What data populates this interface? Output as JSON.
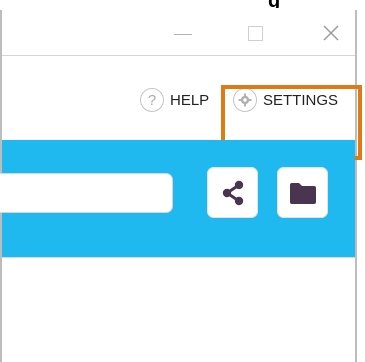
{
  "titlebar": {
    "partial_title": "g",
    "controls": {
      "minimize": "minimize",
      "maximize": "maximize",
      "close": "close"
    }
  },
  "toolbar": {
    "help": {
      "label": "HELP",
      "icon": "question-circle-icon"
    },
    "settings": {
      "label": "SETTINGS",
      "icon": "gear-icon"
    }
  },
  "action_bar": {
    "search_value": "",
    "search_placeholder": "",
    "buttons": [
      {
        "name": "share",
        "icon": "share-icon"
      },
      {
        "name": "folder",
        "icon": "folder-icon"
      }
    ]
  },
  "colors": {
    "accent_bar": "#1fb9ef",
    "highlight": "#e07b13",
    "icon_fill": "#4a3550"
  }
}
